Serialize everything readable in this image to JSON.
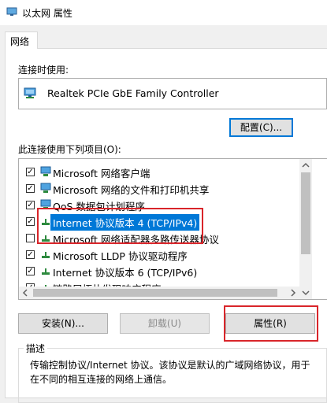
{
  "window": {
    "title": "以太网 属性"
  },
  "tabs": [
    {
      "label": "网络"
    }
  ],
  "connect_using": {
    "label": "连接时使用:",
    "adapter": "Realtek PCIe GbE Family Controller",
    "configure_button": "配置(C)..."
  },
  "items": {
    "label": "此连接使用下列项目(O):",
    "list": [
      {
        "label": "Microsoft 网络客户端",
        "checked": true,
        "icon": "network-client-icon"
      },
      {
        "label": "Microsoft 网络的文件和打印机共享",
        "checked": true,
        "icon": "file-sharing-icon"
      },
      {
        "label": "QoS 数据包计划程序",
        "checked": true,
        "icon": "qos-icon"
      },
      {
        "label": "Internet 协议版本 4 (TCP/IPv4)",
        "checked": true,
        "icon": "protocol-icon",
        "selected": true
      },
      {
        "label": "Microsoft 网络适配器多路传送器协议",
        "checked": false,
        "icon": "protocol-icon"
      },
      {
        "label": "Microsoft LLDP 协议驱动程序",
        "checked": true,
        "icon": "protocol-icon"
      },
      {
        "label": "Internet 协议版本 6 (TCP/IPv6)",
        "checked": true,
        "icon": "protocol-icon"
      },
      {
        "label": "链路层拓扑发现响应程序",
        "checked": true,
        "icon": "protocol-icon"
      }
    ]
  },
  "buttons": {
    "install": "安装(N)...",
    "uninstall": "卸载(U)",
    "properties": "属性(R)"
  },
  "description": {
    "title": "描述",
    "text": "传输控制协议/Internet 协议。该协议是默认的广域网络协议，用于在不同的相互连接的网络上通信。"
  },
  "colors": {
    "selection": "#0078d7",
    "annotation": "#d9252a",
    "window_bg": "#f0f0f0"
  }
}
